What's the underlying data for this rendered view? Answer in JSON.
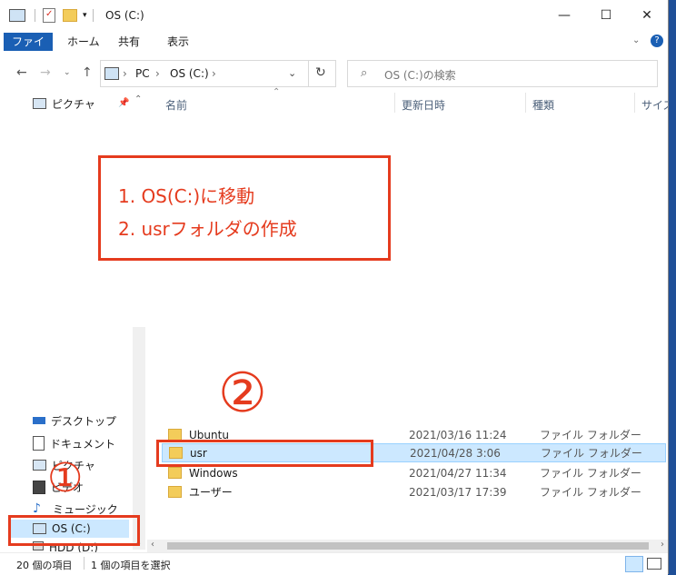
{
  "window": {
    "title": "OS (C:)"
  },
  "controls": {
    "minimize": "—",
    "maximize": "☐",
    "close": "✕"
  },
  "ribbon": {
    "tabs": [
      "ファイル",
      "ホーム",
      "共有",
      "表示"
    ]
  },
  "address": {
    "segments": [
      "PC",
      "OS (C:)"
    ],
    "separators": [
      "›",
      "›"
    ]
  },
  "search": {
    "placeholder": "OS (C:)の検索"
  },
  "columns": {
    "name": "名前",
    "modified": "更新日時",
    "type": "種類",
    "size": "サイズ"
  },
  "sidebar": {
    "top": {
      "label": "ピクチャ"
    },
    "items": [
      {
        "label": "デスクトップ",
        "icon": "desktop-icon"
      },
      {
        "label": "ドキュメント",
        "icon": "document-icon"
      },
      {
        "label": "ピクチャ",
        "icon": "pictures-icon"
      },
      {
        "label": "ビデオ",
        "icon": "video-icon"
      },
      {
        "label": "ミュージック",
        "icon": "music-icon"
      },
      {
        "label": "OS (C:)",
        "icon": "drive-icon"
      },
      {
        "label": "HDD (D:)",
        "icon": "drive-icon"
      }
    ]
  },
  "files": [
    {
      "name": "Ubuntu",
      "modified": "2021/03/16 11:24",
      "type": "ファイル フォルダー"
    },
    {
      "name": "usr",
      "modified": "2021/04/28 3:06",
      "type": "ファイル フォルダー"
    },
    {
      "name": "Windows",
      "modified": "2021/04/27 11:34",
      "type": "ファイル フォルダー"
    },
    {
      "name": "ユーザー",
      "modified": "2021/03/17 17:39",
      "type": "ファイル フォルダー"
    }
  ],
  "status": {
    "count": "20 個の項目",
    "selected": "1 個の項目を選択"
  },
  "annotation": {
    "line1": "1. OS(C:)に移動",
    "line2": "2. usrフォルダの作成",
    "circle1": "①",
    "circle2": "②"
  },
  "colors": {
    "annotation_red": "#e53b1e",
    "file_tab_blue": "#1a5fb4",
    "selected_row": "#cce8ff"
  }
}
